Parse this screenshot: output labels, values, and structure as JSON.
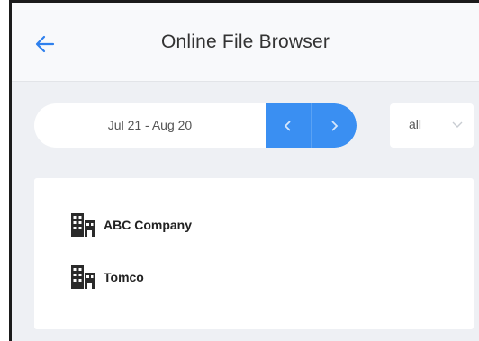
{
  "header": {
    "title": "Online File Browser",
    "back_icon": "arrow-left-icon"
  },
  "date_range": {
    "label": "Jul 21 - Aug 20",
    "prev_icon": "chevron-left-icon",
    "next_icon": "chevron-right-icon"
  },
  "filter": {
    "value": "all",
    "icon": "chevron-down-icon"
  },
  "companies": [
    {
      "name": "ABC Company",
      "icon": "building-icon"
    },
    {
      "name": "Tomco",
      "icon": "building-icon"
    }
  ],
  "colors": {
    "accent": "#3a8ff2",
    "background": "#eef0f4",
    "back_arrow": "#2f80ed"
  }
}
